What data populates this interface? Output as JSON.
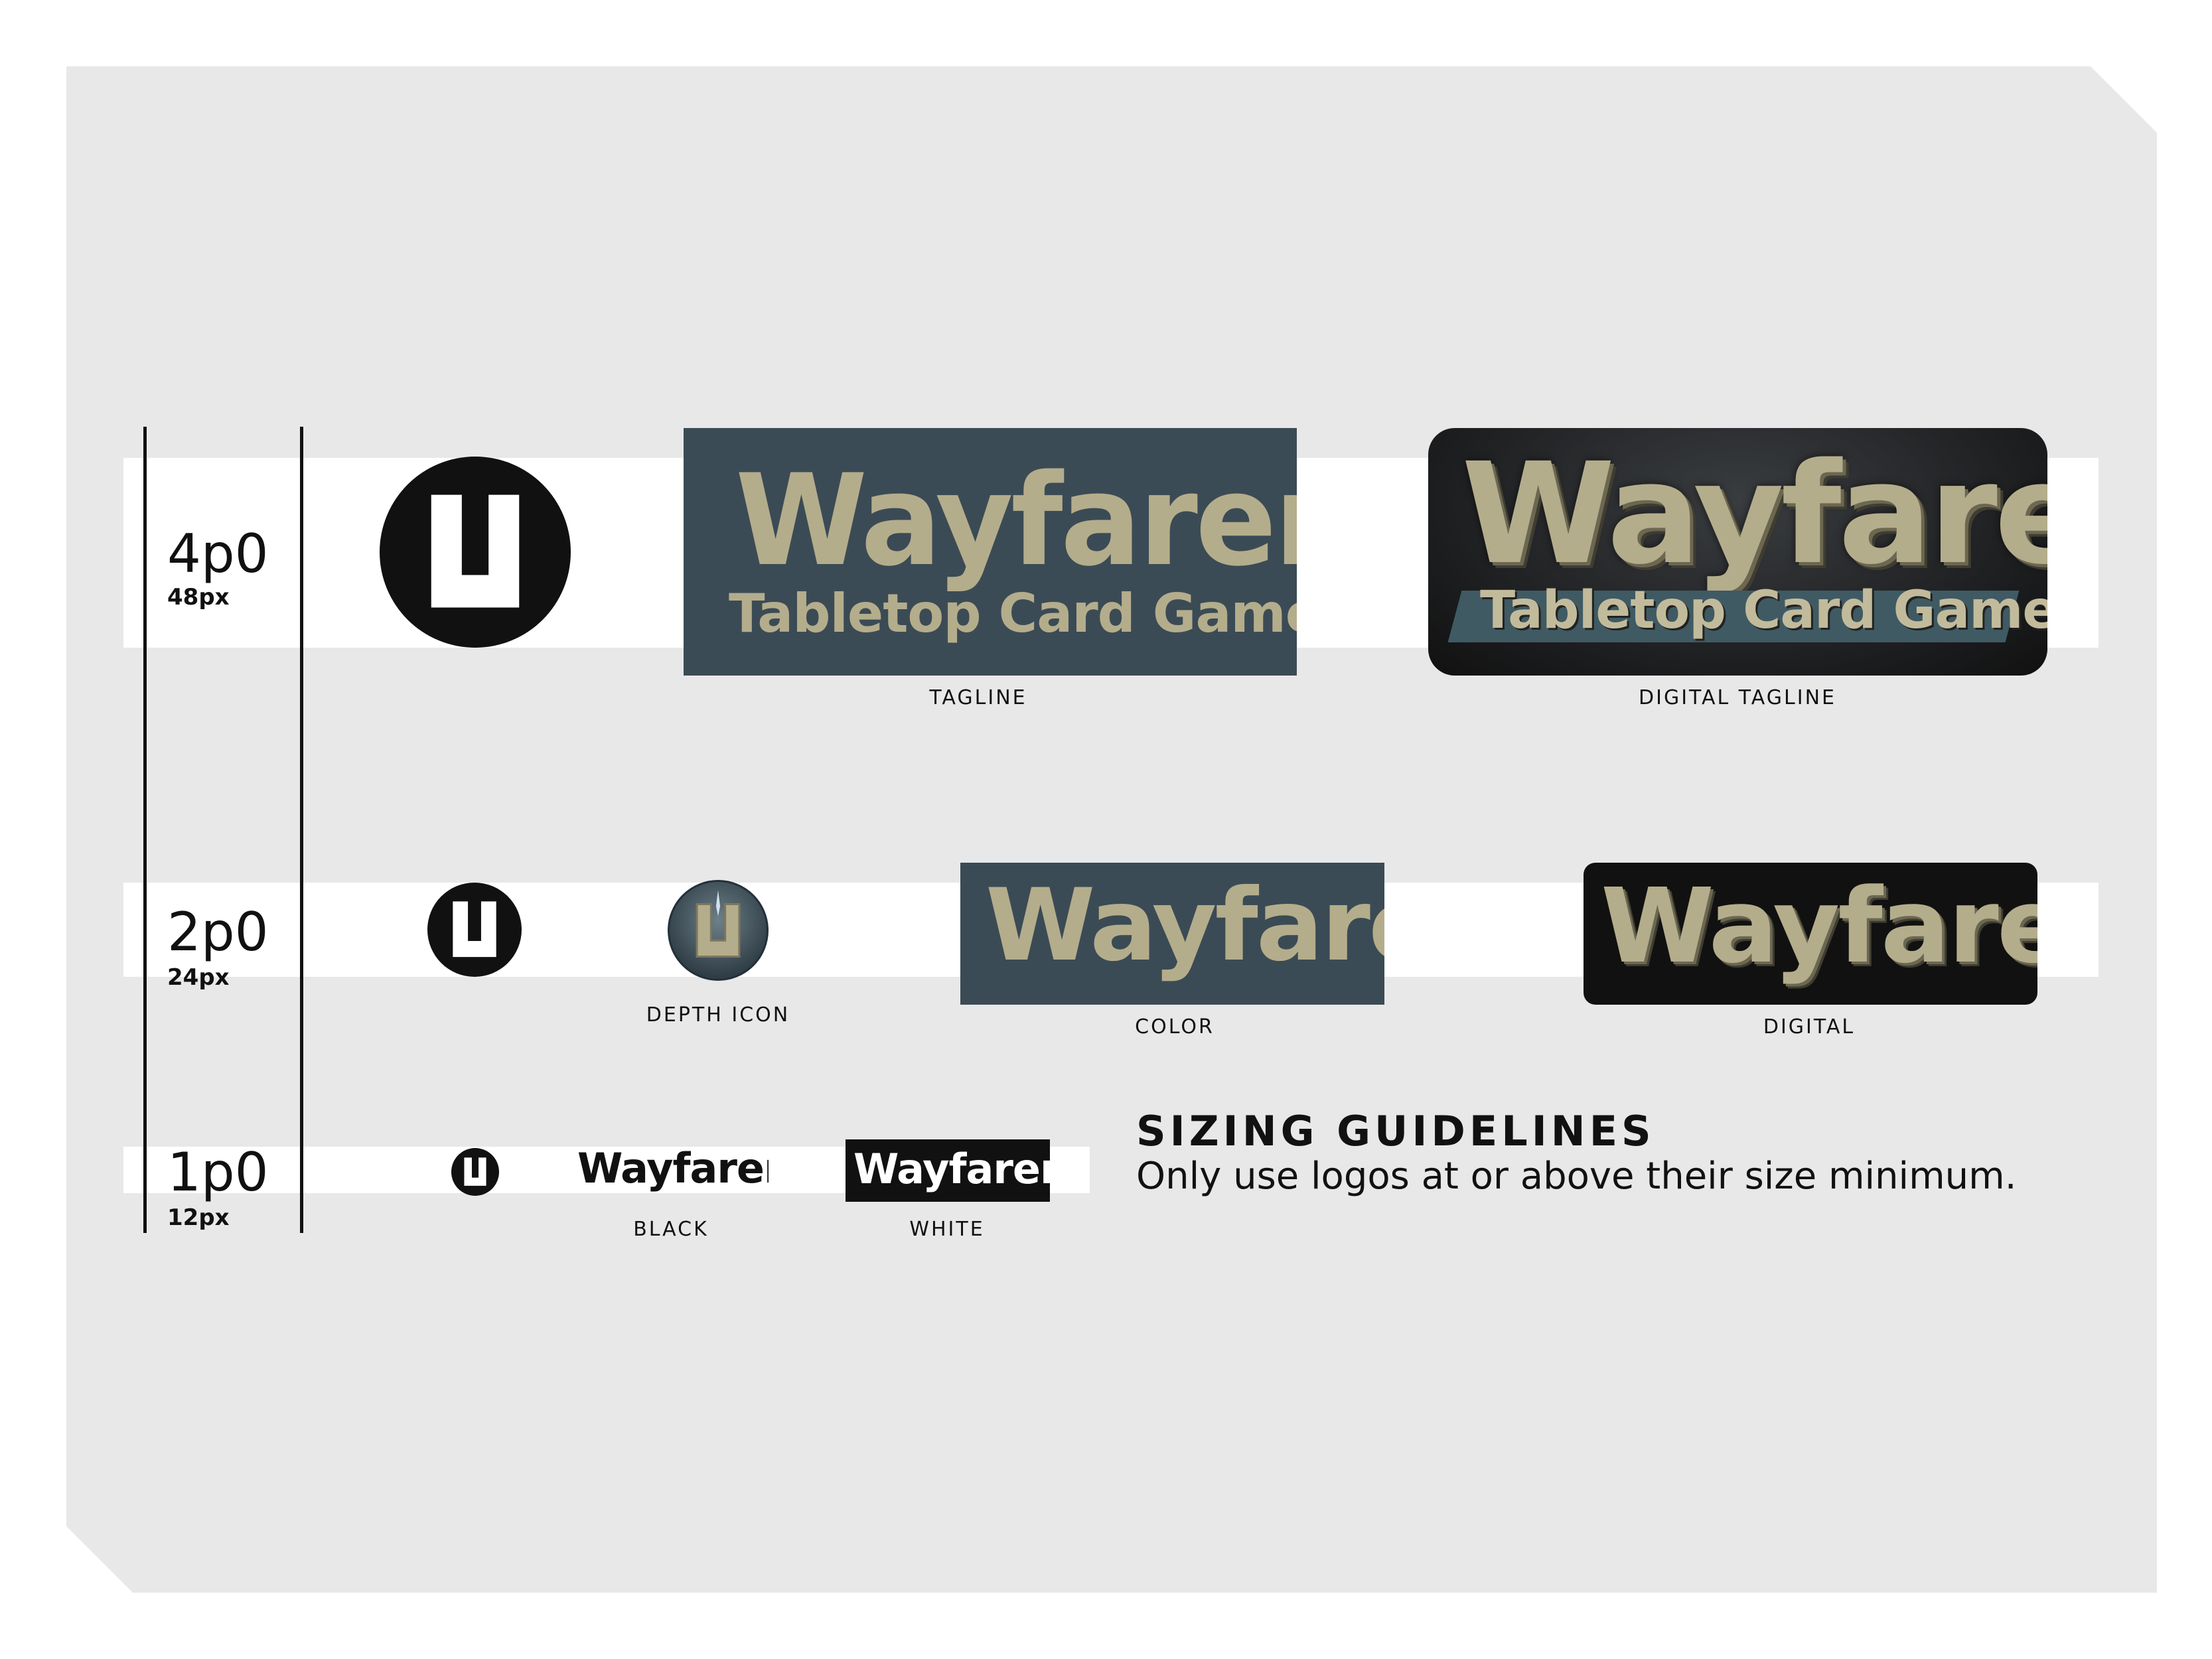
{
  "sizes": {
    "large": {
      "label": "4p0",
      "px": "48px"
    },
    "medium": {
      "label": "2p0",
      "px": "24px"
    },
    "small": {
      "label": "1p0",
      "px": "12px"
    }
  },
  "logos": {
    "brand": "Wayfarer",
    "tagline": "Tabletop Card Game"
  },
  "captions": {
    "tagline": "TAGLINE",
    "digital_tagline": "DIGITAL TAGLINE",
    "depth_icon": "DEPTH ICON",
    "color": "COLOR",
    "digital": "DIGITAL",
    "black": "BLACK",
    "white": "WHITE"
  },
  "guidelines": {
    "title": "SIZING GUIDELINES",
    "body": "Only use logos at or above their size minimum."
  },
  "colors": {
    "slate": "#3b4b55",
    "khaki": "#b4ad8c",
    "black": "#111111"
  }
}
